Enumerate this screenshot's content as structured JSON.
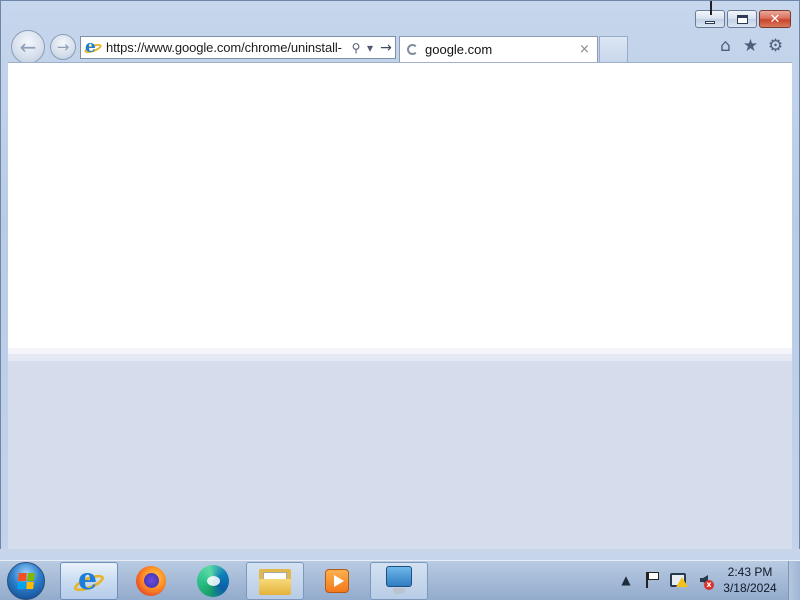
{
  "browser": {
    "address_url": "https://www.google.com/chrome/uninstall-",
    "tab_title": "google.com",
    "tab_close_glyph": "×",
    "addr_search_glyph": "⚲",
    "addr_dropdown_glyph": "▾",
    "addr_go_glyph": "→",
    "back_glyph": "←",
    "forward_glyph": "→",
    "close_glyph": "✕",
    "command_icons": [
      "home-icon",
      "favorites-star-icon",
      "tools-gear-icon"
    ],
    "home_glyph": "⌂",
    "favorites_glyph": "★",
    "tools_glyph": "⚙"
  },
  "taskbar": {
    "pinned": [
      "internet-explorer",
      "firefox",
      "edge",
      "file-explorer",
      "media-player",
      "remote-desktop"
    ],
    "tray_icons": [
      "show-hidden-icons",
      "action-center-flag",
      "network-warning",
      "volume-muted"
    ],
    "tray_arrow_glyph": "▲",
    "volume_x_glyph": "x",
    "time": "2:43 PM",
    "date": "3/18/2024"
  },
  "colors": {
    "accent": "#1e7dd8",
    "taskbar": "#a7bcd8",
    "content_background": "#ffffff"
  }
}
